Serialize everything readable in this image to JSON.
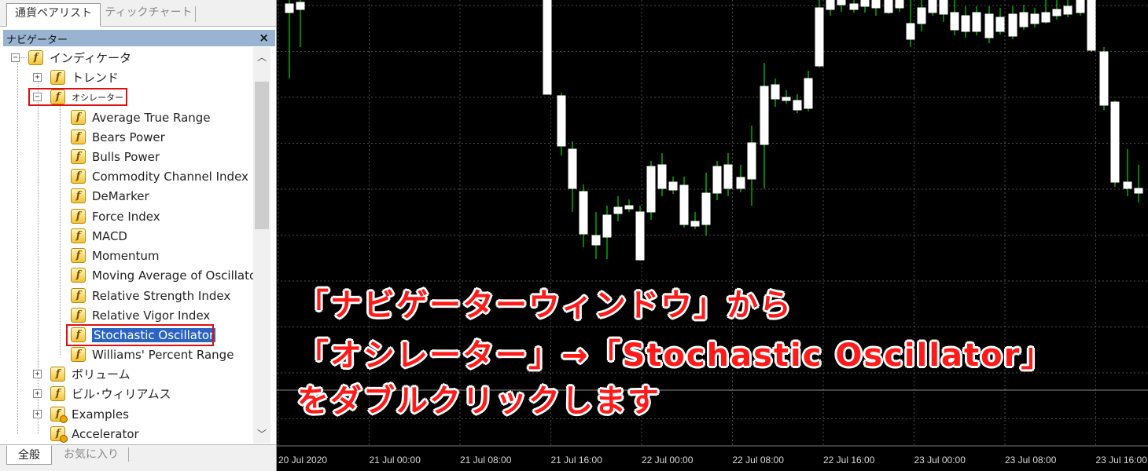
{
  "top_tabs": [
    "通貨ペアリスト",
    "ティックチャート"
  ],
  "navigator": {
    "title": "ナビゲーター",
    "close_glyph": "×",
    "root": "インディケータ",
    "groups": [
      "トレンド",
      "オシレーター",
      "ボリューム",
      "ビル･ウィリアムス",
      "Examples"
    ],
    "oscillators": [
      "Average True Range",
      "Bears Power",
      "Bulls Power",
      "Commodity Channel Index",
      "DeMarker",
      "Force Index",
      "MACD",
      "Momentum",
      "Moving Average of Oscillato",
      "Relative Strength Index",
      "Relative Vigor Index",
      "Stochastic Oscillator",
      "Williams' Percent Range"
    ],
    "selected_item": "Stochastic Oscillator",
    "last_item": "Accelerator",
    "icon_letter": "f"
  },
  "bottom_tabs": [
    "全般",
    "お気に入り"
  ],
  "chart": {
    "type": "candlestick",
    "background": "#000000",
    "bull_color": "#ffffff",
    "wick_color": "#00ff00",
    "grid_color": "#4a4a4a",
    "x_labels": [
      "20 Jul 2020",
      "21 Jul 00:00",
      "21 Jul 08:00",
      "21 Jul 16:00",
      "22 Jul 00:00",
      "22 Jul 08:00",
      "22 Jul 16:00",
      "23 Jul 00:00",
      "23 Jul 08:00",
      "23 Jul 16:00"
    ]
  },
  "chart_data": {
    "type": "candlestick",
    "x_tick_labels": [
      "20 Jul 2020",
      "21 Jul 00:00",
      "21 Jul 08:00",
      "21 Jul 16:00",
      "22 Jul 00:00",
      "22 Jul 08:00",
      "22 Jul 16:00",
      "23 Jul 00:00",
      "23 Jul 08:00",
      "23 Jul 16:00"
    ],
    "grid": true
  },
  "captions": [
    "「ナビゲーターウィンドウ」から",
    "「オシレーター」→「Stochastic Oscillator」",
    "をダブルクリックします"
  ],
  "colors": {
    "caption": "#ff1a1a",
    "highlight_box": "#e01010",
    "selection": "#2b64c4",
    "nav_header": "#99b4d1"
  }
}
